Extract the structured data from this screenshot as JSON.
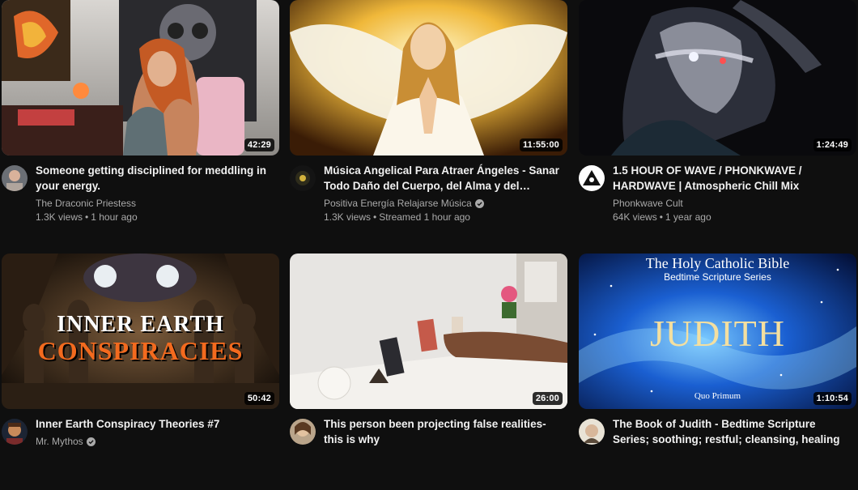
{
  "videos": [
    {
      "title": "Someone getting disciplined for meddling in your energy.",
      "channel": "The Draconic Priestess",
      "views": "1.3K views",
      "age": "1 hour ago",
      "duration": "42:29",
      "verified": false
    },
    {
      "title": "Música Angelical Para Atraer Ángeles - Sanar Todo Daño del Cuerpo, del Alma y del…",
      "channel": "Positiva Energía Relajarse Música",
      "views": "1.3K views",
      "age": "Streamed 1 hour ago",
      "duration": "11:55:00",
      "verified": true
    },
    {
      "title": "1.5 HOUR OF WAVE / PHONKWAVE / HARDWAVE | Atmospheric Chill Mix",
      "channel": "Phonkwave Cult",
      "views": "64K views",
      "age": "1 year ago",
      "duration": "1:24:49",
      "verified": false
    },
    {
      "title": "Inner Earth Conspiracy Theories #7",
      "channel": "Mr. Mythos",
      "views": "",
      "age": "",
      "duration": "50:42",
      "verified": true,
      "thumb_text_1": "INNER EARTH",
      "thumb_text_2": "CONSPIRACIES"
    },
    {
      "title": "This person been projecting false realities- this is why",
      "channel": "",
      "views": "",
      "age": "",
      "duration": "26:00",
      "verified": false
    },
    {
      "title": "The Book of Judith - Bedtime Scripture Series; soothing; restful; cleansing, healing",
      "channel": "",
      "views": "",
      "age": "",
      "duration": "1:10:54",
      "verified": false,
      "thumb_text_1": "The Holy Catholic Bible",
      "thumb_text_2": "Bedtime Scripture Series",
      "thumb_text_3": "JUDITH",
      "thumb_text_4": "Quo Primum"
    }
  ],
  "icons": {
    "verified": "verified-check-icon",
    "separator": "•"
  },
  "colors": {
    "background": "#0f0f0f",
    "title": "#f1f1f1",
    "secondary": "#aaaaaa"
  }
}
